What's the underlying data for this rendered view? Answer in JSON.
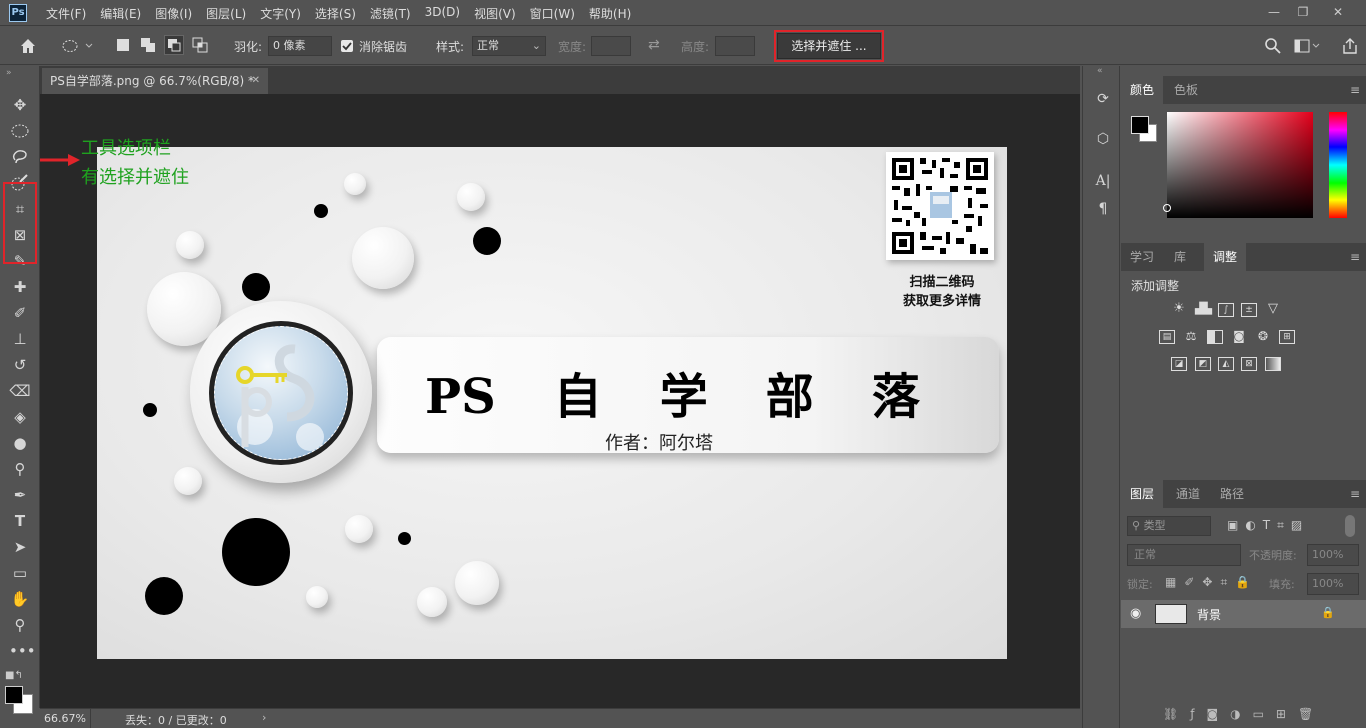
{
  "app": {
    "logo": "Ps"
  },
  "menu": [
    "文件(F)",
    "编辑(E)",
    "图像(I)",
    "图层(L)",
    "文字(Y)",
    "选择(S)",
    "滤镜(T)",
    "3D(D)",
    "视图(V)",
    "窗口(W)",
    "帮助(H)"
  ],
  "window_buttons": {
    "minimize": "—",
    "restore": "❐",
    "close": "✕"
  },
  "options": {
    "feather_label": "羽化:",
    "feather_value": "0 像素",
    "antialias_label": "消除锯齿",
    "style_label": "样式:",
    "style_value": "正常",
    "width_label": "宽度:",
    "height_label": "高度:",
    "refine_button": "选择并遮住 ..."
  },
  "document": {
    "tab_title": "PS自学部落.png @ 66.7%(RGB/8) *",
    "close": "✕"
  },
  "canvas": {
    "title_chars": [
      "PS",
      "自",
      "学",
      "部",
      "落"
    ],
    "author": "作者：阿尔塔",
    "qr_line1": "扫描二维码",
    "qr_line2": "获取更多详情"
  },
  "annotation": {
    "line1": "工具选项栏",
    "line2": "有选择并遮住"
  },
  "status": {
    "zoom": "66.67%",
    "info": "丢失：0 / 已更改：0"
  },
  "panels": {
    "color_tabs": [
      "颜色",
      "色板"
    ],
    "adjust_tabs": [
      "学习",
      "库",
      "调整"
    ],
    "add_adjustment": "添加调整",
    "layers_tabs": [
      "图层",
      "通道",
      "路径"
    ],
    "kind_filter": "类型",
    "blend_mode": "正常",
    "opacity_label": "不透明度:",
    "opacity_value": "100%",
    "lock_label": "锁定:",
    "fill_label": "填充:",
    "fill_value": "100%",
    "layer_name": "背景"
  },
  "colors": {
    "highlight": "#e0242a",
    "annotation": "#1fa21f",
    "panel_bg": "#535353"
  }
}
